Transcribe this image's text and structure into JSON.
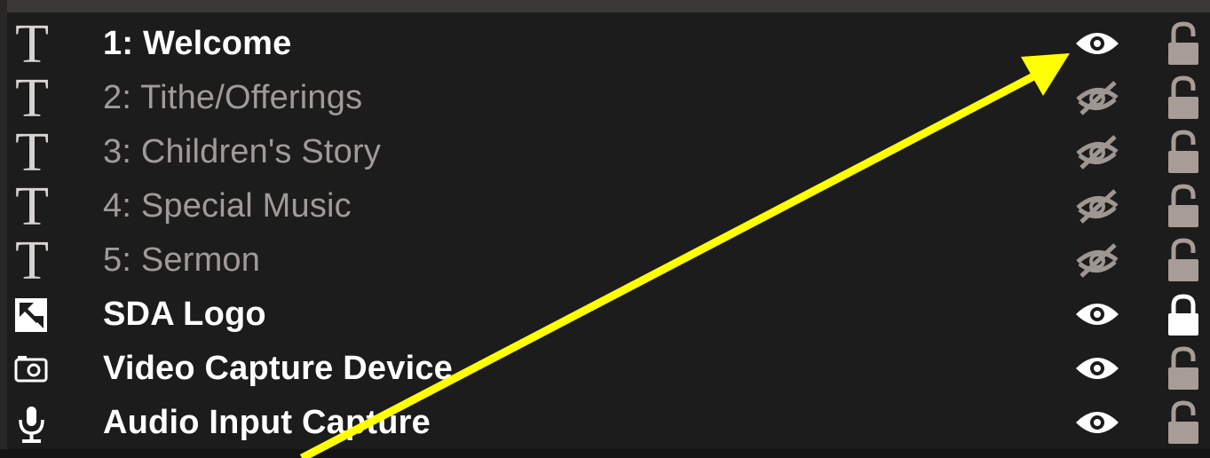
{
  "sources": [
    {
      "label": "1: Welcome",
      "type": "text",
      "visible": true,
      "locked": false,
      "active": true
    },
    {
      "label": "2: Tithe/Offerings",
      "type": "text",
      "visible": false,
      "locked": false,
      "active": false
    },
    {
      "label": "3: Children's Story",
      "type": "text",
      "visible": false,
      "locked": false,
      "active": false
    },
    {
      "label": "4: Special Music",
      "type": "text",
      "visible": false,
      "locked": false,
      "active": false
    },
    {
      "label": "5: Sermon",
      "type": "text",
      "visible": false,
      "locked": false,
      "active": false
    },
    {
      "label": "SDA Logo",
      "type": "image",
      "visible": true,
      "locked": true,
      "active": true
    },
    {
      "label": "Video Capture Device",
      "type": "camera",
      "visible": true,
      "locked": false,
      "active": true
    },
    {
      "label": "Audio Input Capture",
      "type": "microphone",
      "visible": true,
      "locked": false,
      "active": true
    }
  ],
  "icons": {
    "text": "text-source-icon",
    "image": "image-source-icon",
    "camera": "camera-source-icon",
    "microphone": "microphone-source-icon",
    "visible": "eye-icon",
    "hidden": "eye-slash-icon",
    "unlocked": "unlocked-padlock-icon",
    "locked": "locked-padlock-icon"
  },
  "colors": {
    "background": "#1c1c1c",
    "active_text": "#ffffff",
    "muted_text": "#a09b98",
    "unlocked_lock": "#a89c96",
    "locked_lock": "#ffffff",
    "annotation_arrow": "#ffff00"
  }
}
